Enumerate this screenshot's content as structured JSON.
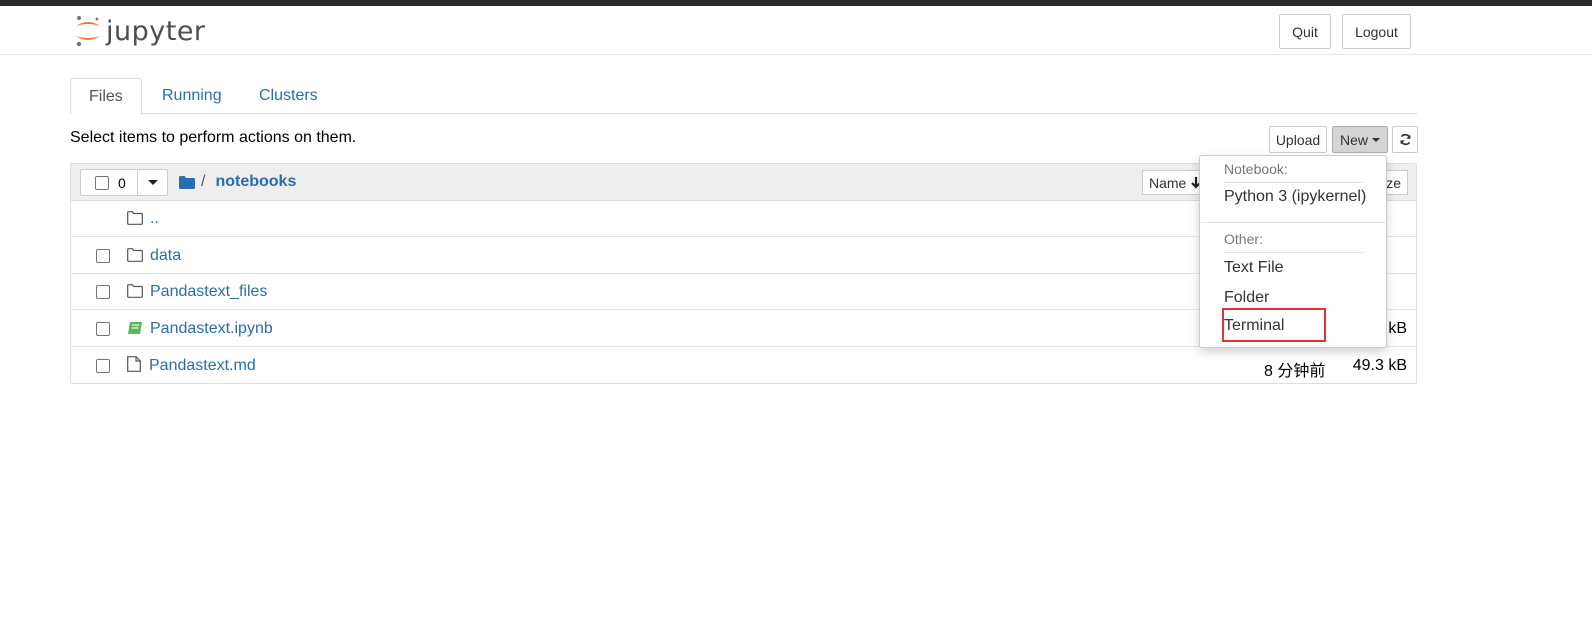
{
  "app": {
    "logo_text": "jupyter"
  },
  "header": {
    "quit_label": "Quit",
    "logout_label": "Logout"
  },
  "tabs": [
    {
      "label": "Files",
      "active": true
    },
    {
      "label": "Running",
      "active": false
    },
    {
      "label": "Clusters",
      "active": false
    }
  ],
  "toolbar": {
    "hint": "Select items to perform actions on them.",
    "upload_label": "Upload",
    "new_label": "New"
  },
  "list_header": {
    "selected_count": "0",
    "breadcrumb_sep": "/",
    "breadcrumb_dir": "notebooks",
    "sort_name_label": "Name",
    "sort_size_label": "ze"
  },
  "rows": [
    {
      "name": "..",
      "type": "folder",
      "modified": "",
      "size": ""
    },
    {
      "name": "data",
      "type": "folder",
      "modified": "",
      "size": ""
    },
    {
      "name": "Pandastext_files",
      "type": "folder",
      "modified": "",
      "size": ""
    },
    {
      "name": "Pandastext.ipynb",
      "type": "notebook",
      "modified": "",
      "size": "kB"
    },
    {
      "name": "Pandastext.md",
      "type": "file",
      "modified": "8 分钟前",
      "size": "49.3 kB"
    }
  ],
  "new_menu": {
    "notebook_header": "Notebook:",
    "kernel_item": "Python 3 (ipykernel)",
    "other_header": "Other:",
    "items": [
      "Text File",
      "Folder",
      "Terminal"
    ],
    "highlighted_item": "Terminal"
  },
  "colors": {
    "link": "#296eaa",
    "highlight_box": "#e43232",
    "logo_orange": "#f37726"
  }
}
